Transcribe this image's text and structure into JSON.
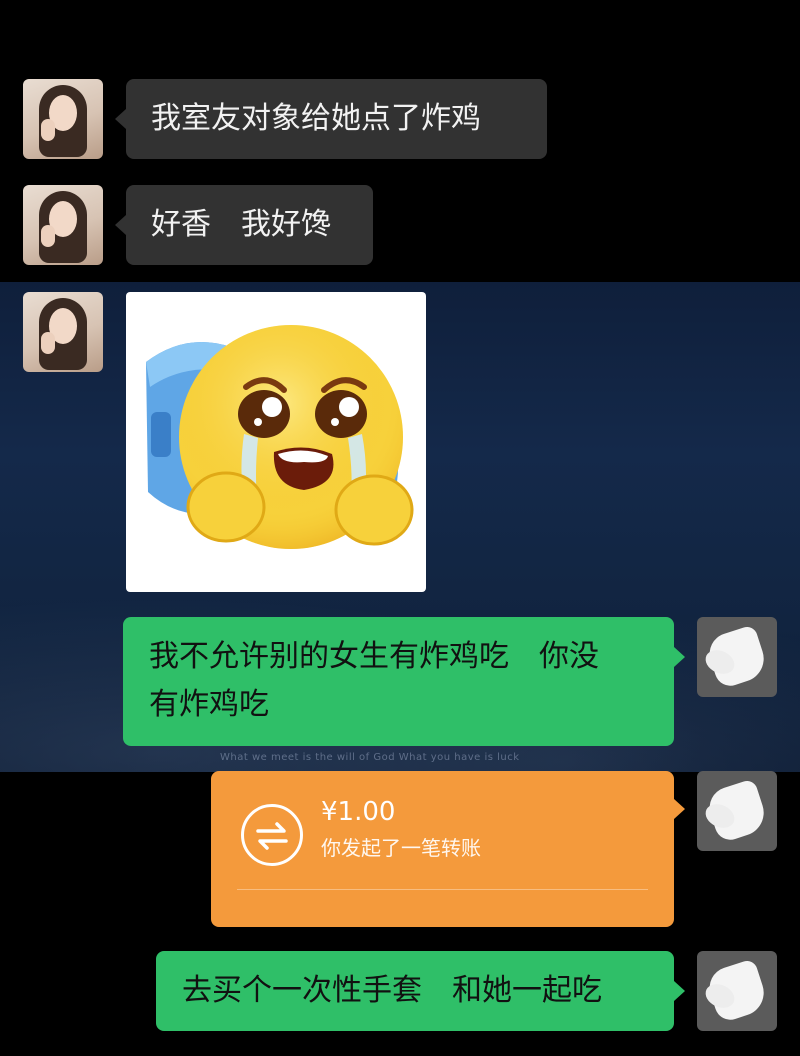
{
  "chat": {
    "messages": [
      {
        "text": "我室友对象给她点了炸鸡"
      },
      {
        "text": "好香　我好馋"
      },
      {
        "sticker": "crying-emoji-sticker"
      },
      {
        "line1": "我不允许别的女生有炸鸡吃　你没",
        "line2": "有炸鸡吃"
      },
      {
        "transfer_amount": "¥1.00",
        "transfer_desc": "你发起了一笔转账"
      },
      {
        "text": "去买个一次性手套　和她一起吃"
      }
    ]
  },
  "background": {
    "caption": "What we meet is the will of God What you have is luck"
  },
  "colors": {
    "incoming_bubble": "#323232",
    "outgoing_bubble": "#2fbf68",
    "transfer_card": "#f49a3c"
  }
}
